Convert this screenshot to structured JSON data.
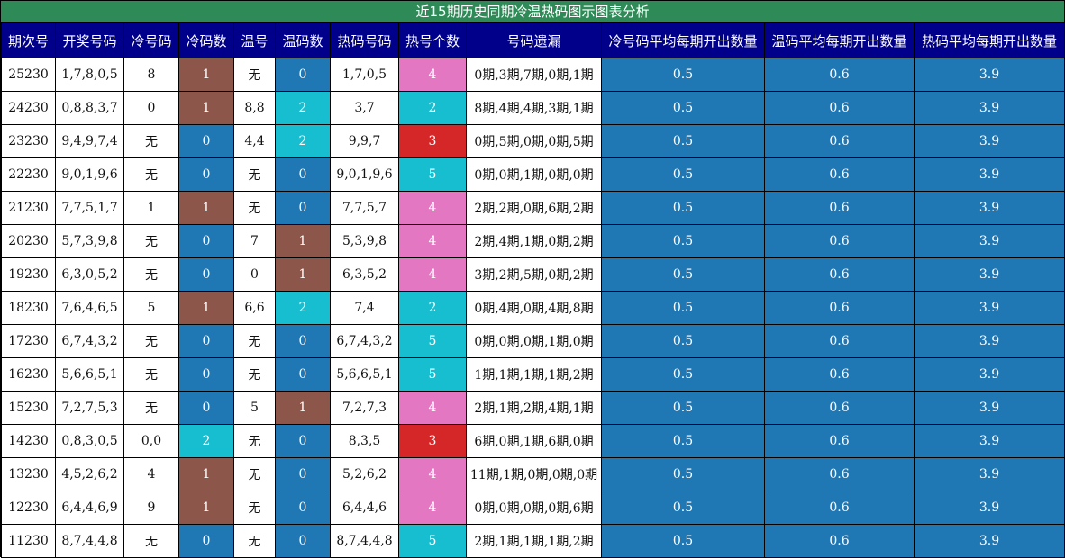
{
  "title": "近15期历史同期冷温热码图示图表分析",
  "headers": [
    "期次号",
    "开奖号码",
    "冷号码",
    "冷码数",
    "温号",
    "温码数",
    "热码号码",
    "热号个数",
    "号码遗漏",
    "冷号码平均每期开出数量",
    "温码平均每期开出数量",
    "热码平均每期开出数量"
  ],
  "rows": [
    {
      "period": "25230",
      "draw": "1,7,8,0,5",
      "cold": "8",
      "cold_count": "1",
      "warm": "无",
      "warm_count": "0",
      "hot": "1,7,0,5",
      "hot_count": "4",
      "miss": "0期,3期,7期,0期,1期",
      "avg_cold": "0.5",
      "avg_warm": "0.6",
      "avg_hot": "3.9"
    },
    {
      "period": "24230",
      "draw": "0,8,8,3,7",
      "cold": "0",
      "cold_count": "1",
      "warm": "8,8",
      "warm_count": "2",
      "hot": "3,7",
      "hot_count": "2",
      "miss": "8期,4期,4期,3期,1期",
      "avg_cold": "0.5",
      "avg_warm": "0.6",
      "avg_hot": "3.9"
    },
    {
      "period": "23230",
      "draw": "9,4,9,7,4",
      "cold": "无",
      "cold_count": "0",
      "warm": "4,4",
      "warm_count": "2",
      "hot": "9,9,7",
      "hot_count": "3",
      "miss": "0期,5期,0期,0期,5期",
      "avg_cold": "0.5",
      "avg_warm": "0.6",
      "avg_hot": "3.9"
    },
    {
      "period": "22230",
      "draw": "9,0,1,9,6",
      "cold": "无",
      "cold_count": "0",
      "warm": "无",
      "warm_count": "0",
      "hot": "9,0,1,9,6",
      "hot_count": "5",
      "miss": "0期,0期,1期,0期,0期",
      "avg_cold": "0.5",
      "avg_warm": "0.6",
      "avg_hot": "3.9"
    },
    {
      "period": "21230",
      "draw": "7,7,5,1,7",
      "cold": "1",
      "cold_count": "1",
      "warm": "无",
      "warm_count": "0",
      "hot": "7,7,5,7",
      "hot_count": "4",
      "miss": "2期,2期,0期,6期,2期",
      "avg_cold": "0.5",
      "avg_warm": "0.6",
      "avg_hot": "3.9"
    },
    {
      "period": "20230",
      "draw": "5,7,3,9,8",
      "cold": "无",
      "cold_count": "0",
      "warm": "7",
      "warm_count": "1",
      "hot": "5,3,9,8",
      "hot_count": "4",
      "miss": "2期,4期,1期,0期,2期",
      "avg_cold": "0.5",
      "avg_warm": "0.6",
      "avg_hot": "3.9"
    },
    {
      "period": "19230",
      "draw": "6,3,0,5,2",
      "cold": "无",
      "cold_count": "0",
      "warm": "0",
      "warm_count": "1",
      "hot": "6,3,5,2",
      "hot_count": "4",
      "miss": "3期,2期,5期,0期,2期",
      "avg_cold": "0.5",
      "avg_warm": "0.6",
      "avg_hot": "3.9"
    },
    {
      "period": "18230",
      "draw": "7,6,4,6,5",
      "cold": "5",
      "cold_count": "1",
      "warm": "6,6",
      "warm_count": "2",
      "hot": "7,4",
      "hot_count": "2",
      "miss": "0期,4期,0期,4期,8期",
      "avg_cold": "0.5",
      "avg_warm": "0.6",
      "avg_hot": "3.9"
    },
    {
      "period": "17230",
      "draw": "6,7,4,3,2",
      "cold": "无",
      "cold_count": "0",
      "warm": "无",
      "warm_count": "0",
      "hot": "6,7,4,3,2",
      "hot_count": "5",
      "miss": "0期,0期,0期,1期,0期",
      "avg_cold": "0.5",
      "avg_warm": "0.6",
      "avg_hot": "3.9"
    },
    {
      "period": "16230",
      "draw": "5,6,6,5,1",
      "cold": "无",
      "cold_count": "0",
      "warm": "无",
      "warm_count": "0",
      "hot": "5,6,6,5,1",
      "hot_count": "5",
      "miss": "1期,1期,1期,1期,2期",
      "avg_cold": "0.5",
      "avg_warm": "0.6",
      "avg_hot": "3.9"
    },
    {
      "period": "15230",
      "draw": "7,2,7,5,3",
      "cold": "无",
      "cold_count": "0",
      "warm": "5",
      "warm_count": "1",
      "hot": "7,2,7,3",
      "hot_count": "4",
      "miss": "2期,1期,2期,4期,1期",
      "avg_cold": "0.5",
      "avg_warm": "0.6",
      "avg_hot": "3.9"
    },
    {
      "period": "14230",
      "draw": "0,8,3,0,5",
      "cold": "0,0",
      "cold_count": "2",
      "warm": "无",
      "warm_count": "0",
      "hot": "8,3,5",
      "hot_count": "3",
      "miss": "6期,0期,1期,6期,0期",
      "avg_cold": "0.5",
      "avg_warm": "0.6",
      "avg_hot": "3.9"
    },
    {
      "period": "13230",
      "draw": "4,5,2,6,2",
      "cold": "4",
      "cold_count": "1",
      "warm": "无",
      "warm_count": "0",
      "hot": "5,2,6,2",
      "hot_count": "4",
      "miss": "11期,1期,0期,0期,0期",
      "avg_cold": "0.5",
      "avg_warm": "0.6",
      "avg_hot": "3.9"
    },
    {
      "period": "12230",
      "draw": "6,4,4,6,9",
      "cold": "9",
      "cold_count": "1",
      "warm": "无",
      "warm_count": "0",
      "hot": "6,4,4,6",
      "hot_count": "4",
      "miss": "0期,0期,0期,0期,6期",
      "avg_cold": "0.5",
      "avg_warm": "0.6",
      "avg_hot": "3.9"
    },
    {
      "period": "11230",
      "draw": "8,7,4,4,8",
      "cold": "无",
      "cold_count": "0",
      "warm": "无",
      "warm_count": "0",
      "hot": "8,7,4,4,8",
      "hot_count": "5",
      "miss": "2期,1期,1期,1期,2期",
      "avg_cold": "0.5",
      "avg_warm": "0.6",
      "avg_hot": "3.9"
    }
  ],
  "count_colors": {
    "0": "#1f77b4",
    "1": "#8c564b",
    "2": "#17becf",
    "3": "#d62728",
    "4": "#e377c2",
    "5": "#17becf"
  },
  "header_bg": "#00008b",
  "title_bg": "#2e8b57",
  "avg_bg": "#1f77b4"
}
